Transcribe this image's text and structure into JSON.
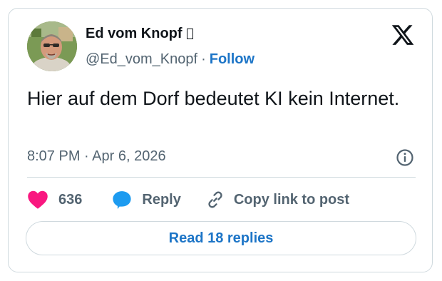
{
  "author": {
    "display_name": "Ed vom Knopf",
    "handle": "@Ed_vom_Knopf",
    "separator": "·",
    "follow_label": "Follow"
  },
  "tweet": {
    "text": "Hier auf dem Dorf bedeutet KI kein Internet.",
    "timestamp": "8:07 PM · Apr 6, 2026"
  },
  "actions": {
    "like_count": "636",
    "reply_label": "Reply",
    "copy_link_label": "Copy link to post"
  },
  "read_replies_label": "Read 18 replies",
  "icons": {
    "brand": "x-logo-icon",
    "info": "info-icon",
    "like": "heart-icon",
    "reply": "speech-bubble-icon",
    "copy": "link-icon"
  },
  "colors": {
    "text": "#0f1419",
    "secondary": "#536471",
    "accent": "#1d75c7",
    "like": "#f91880",
    "reply": "#1d9bf0",
    "border": "#cfd9de"
  }
}
